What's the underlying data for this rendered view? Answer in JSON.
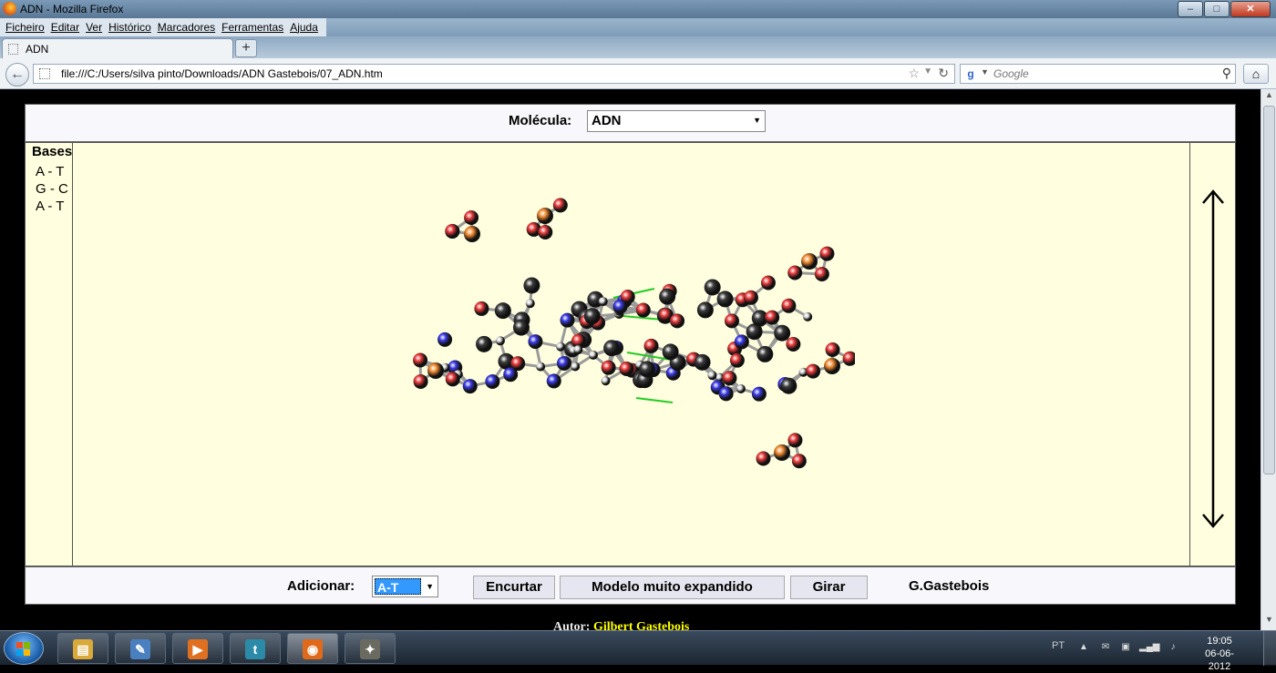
{
  "window": {
    "title": "ADN - Mozilla Firefox",
    "buttons": {
      "minimize": "–",
      "maximize": "□",
      "close": "✕"
    }
  },
  "menubar": {
    "items": [
      "Ficheiro",
      "Editar",
      "Ver",
      "Histórico",
      "Marcadores",
      "Ferramentas",
      "Ajuda"
    ]
  },
  "tabs": [
    {
      "label": "ADN"
    }
  ],
  "new_tab_label": "+",
  "navbar": {
    "url": "file:///C:/Users/silva pinto/Downloads/ADN Gastebois/07_ADN.htm",
    "search_placeholder": "Google",
    "search_engine_glyph": "g"
  },
  "page": {
    "molecule_label": "Molécula:",
    "molecule_value": "ADN",
    "bases_title": "Bases",
    "bases": [
      "A - T",
      "G - C",
      "A - T"
    ],
    "add_label": "Adicionar:",
    "add_value": "A-T",
    "buttons": {
      "shorten": "Encurtar",
      "expanded_model": "Modelo muito expandido",
      "rotate": "Girar"
    },
    "author_code": "G.Gastebois",
    "author_prefix": "Autor:",
    "author_name": "Gilbert Gastebois"
  },
  "taskbar": {
    "apps": [
      {
        "name": "windows-explorer",
        "glyph": "▤",
        "color": "#d9a93a"
      },
      {
        "name": "paint",
        "glyph": "✎",
        "color": "#4a7fc0"
      },
      {
        "name": "media-player",
        "glyph": "▶",
        "color": "#e07020"
      },
      {
        "name": "tumblr",
        "glyph": "t",
        "color": "#2b8aa8"
      },
      {
        "name": "firefox",
        "glyph": "◉",
        "color": "#e06a1a"
      },
      {
        "name": "gimp",
        "glyph": "✦",
        "color": "#6a6a60"
      }
    ],
    "language": "PT",
    "time": "19:05",
    "date": "06-06-2012"
  },
  "colors": {
    "viewer_bg": "#ffffdf",
    "carbon": "#3a3a3a",
    "oxygen": "#e83a3a",
    "nitrogen": "#3a3ae8",
    "phosphorus": "#f08a30",
    "hydrogen": "#dcdcdc",
    "hbond": "#22cc22"
  }
}
